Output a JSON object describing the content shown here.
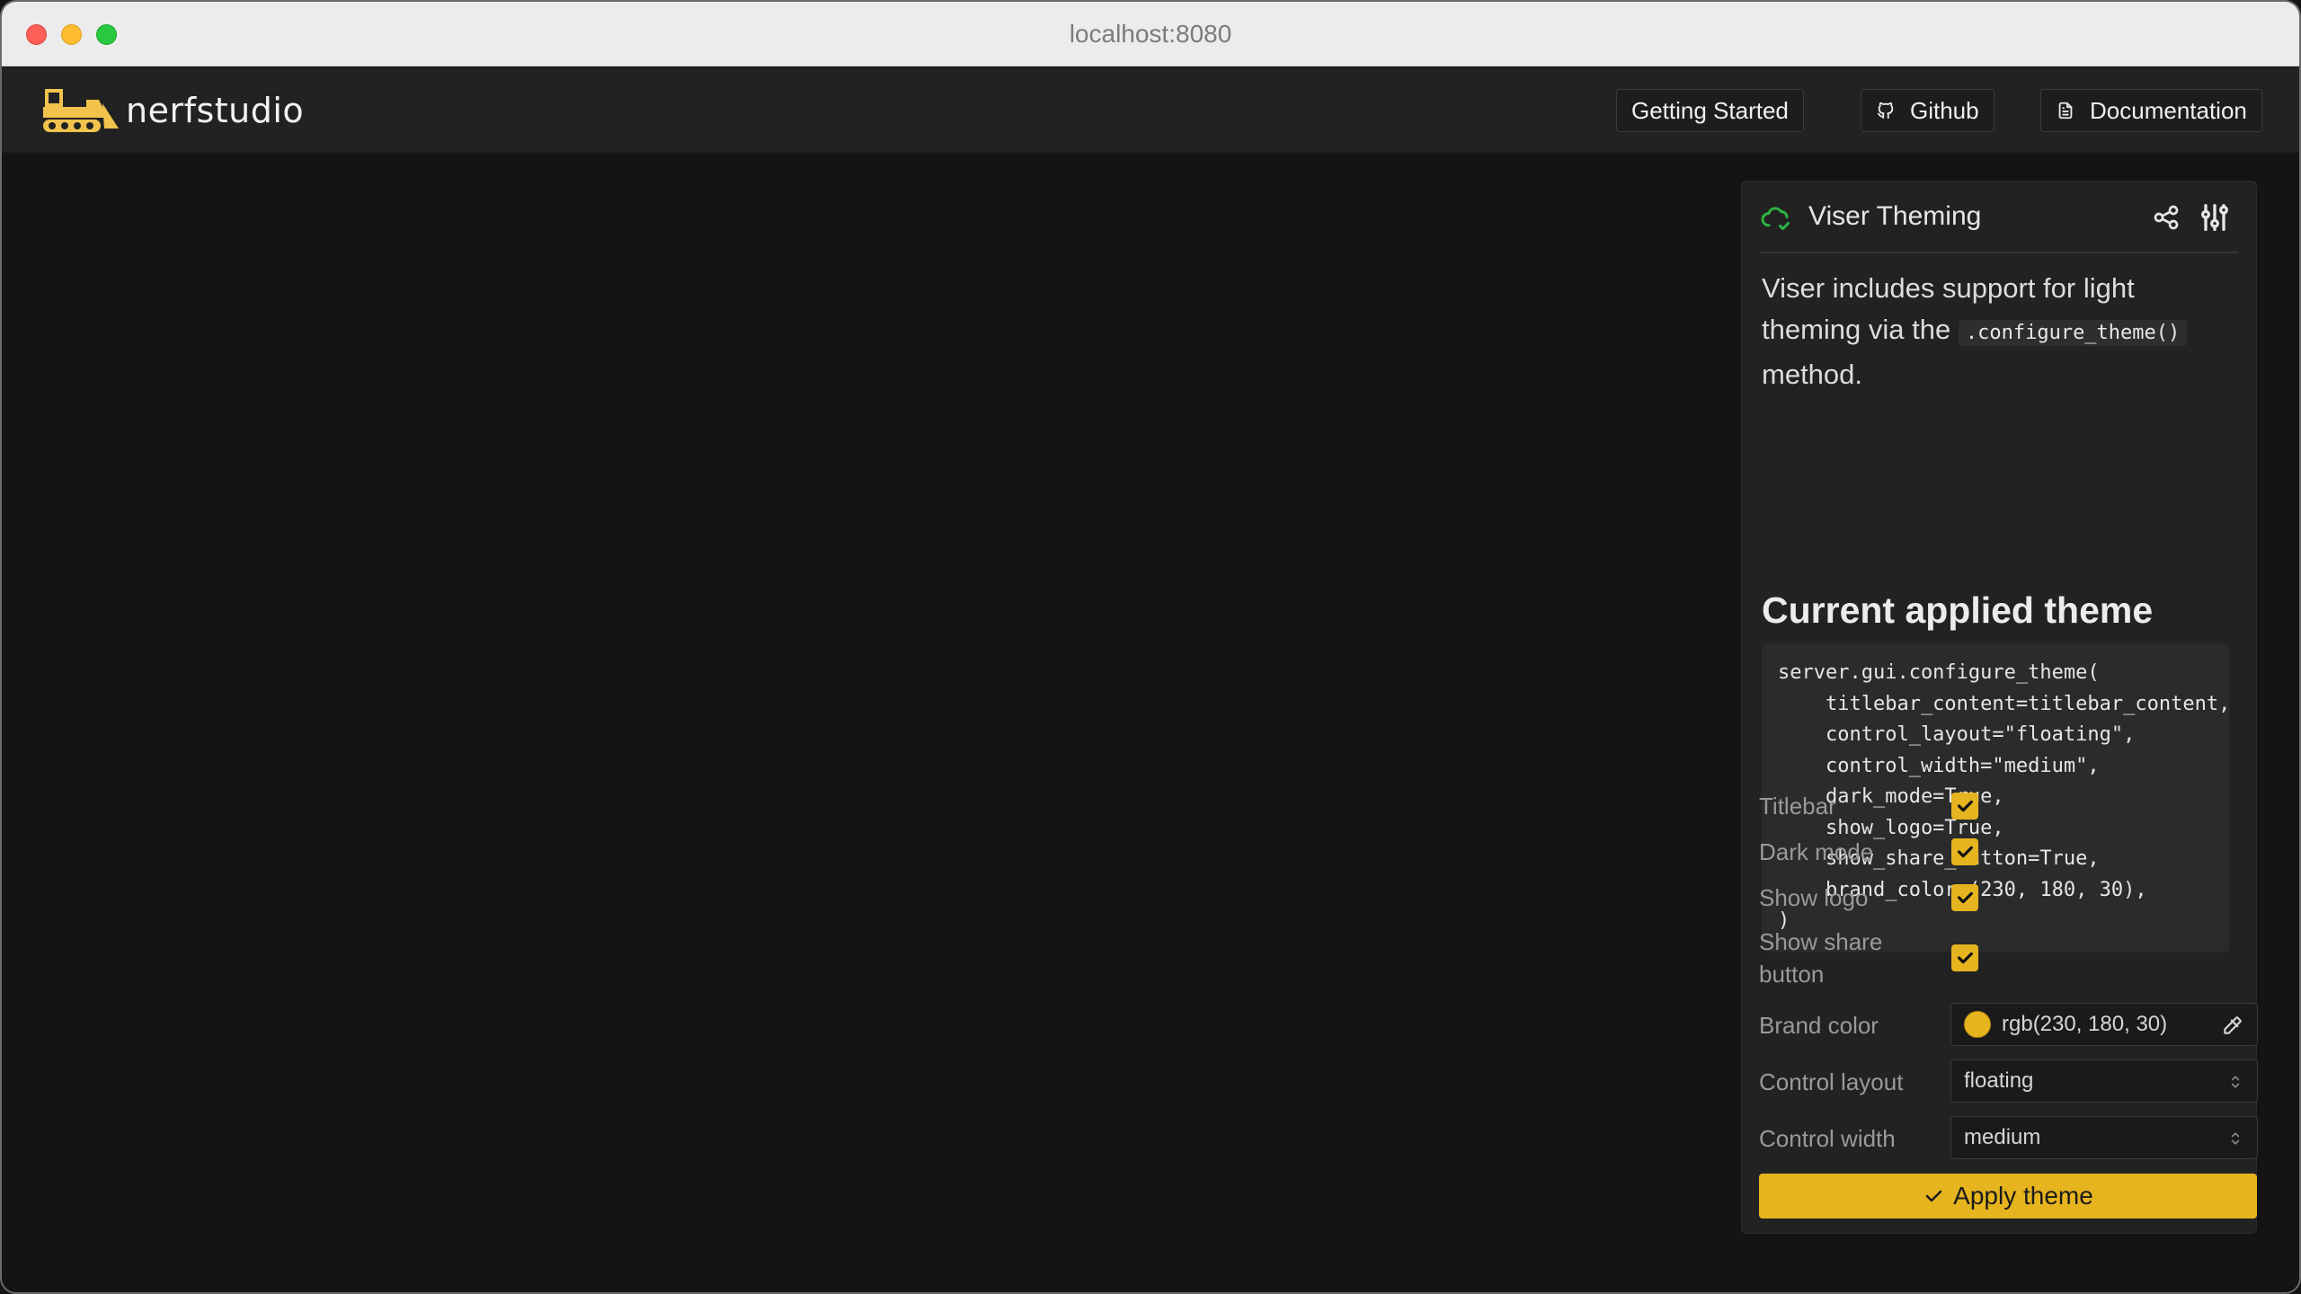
{
  "browser": {
    "url": "localhost:8080"
  },
  "topbar": {
    "logo_text": "nerfstudio",
    "links": [
      {
        "label": "Getting Started",
        "icon": "none"
      },
      {
        "label": "Github",
        "icon": "github-icon"
      },
      {
        "label": "Documentation",
        "icon": "document-icon"
      }
    ]
  },
  "panel": {
    "title": "Viser Theming",
    "desc_part1": "Viser includes support for light theming via the",
    "desc_code": ".configure_theme()",
    "desc_part2": "method.",
    "heading": "Current applied theme",
    "code_lines": [
      "server.gui.configure_theme(",
      "    titlebar_content=titlebar_content,",
      "    control_layout=\"floating\",",
      "    control_width=\"medium\",",
      "    dark_mode=True,",
      "    show_logo=True,",
      "    show_share_button=True,",
      "    brand_color=(230, 180, 30),",
      ")"
    ],
    "controls": {
      "titlebar": {
        "label": "Titlebar",
        "checked": true
      },
      "dark_mode": {
        "label": "Dark mode",
        "checked": true
      },
      "show_logo": {
        "label": "Show logo",
        "checked": true
      },
      "show_share": {
        "label": "Show share button",
        "checked": true
      },
      "brand_color": {
        "label": "Brand color",
        "value": "rgb(230, 180, 30)"
      },
      "control_layout": {
        "label": "Control layout",
        "value": "floating"
      },
      "control_width": {
        "label": "Control width",
        "value": "medium"
      }
    },
    "apply_label": "Apply theme"
  },
  "colors": {
    "brand": "#e6b41e",
    "status_ok": "#2fb344"
  }
}
